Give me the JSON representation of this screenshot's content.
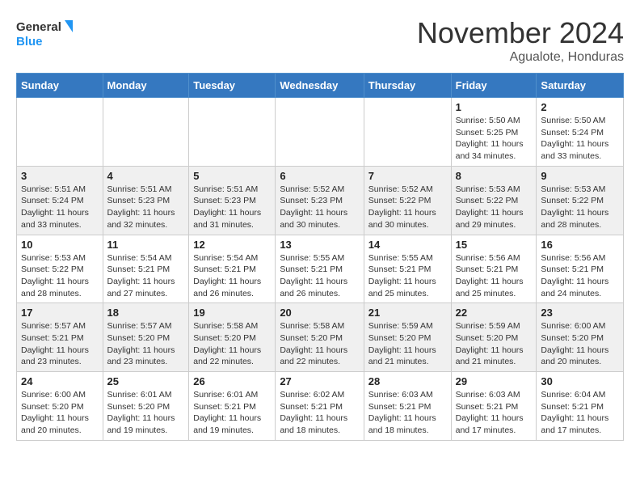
{
  "header": {
    "logo_general": "General",
    "logo_blue": "Blue",
    "month_title": "November 2024",
    "location": "Agualote, Honduras"
  },
  "calendar": {
    "days_of_week": [
      "Sunday",
      "Monday",
      "Tuesday",
      "Wednesday",
      "Thursday",
      "Friday",
      "Saturday"
    ],
    "weeks": [
      [
        {
          "day": "",
          "info": ""
        },
        {
          "day": "",
          "info": ""
        },
        {
          "day": "",
          "info": ""
        },
        {
          "day": "",
          "info": ""
        },
        {
          "day": "",
          "info": ""
        },
        {
          "day": "1",
          "info": "Sunrise: 5:50 AM\nSunset: 5:25 PM\nDaylight: 11 hours and 34 minutes."
        },
        {
          "day": "2",
          "info": "Sunrise: 5:50 AM\nSunset: 5:24 PM\nDaylight: 11 hours and 33 minutes."
        }
      ],
      [
        {
          "day": "3",
          "info": "Sunrise: 5:51 AM\nSunset: 5:24 PM\nDaylight: 11 hours and 33 minutes."
        },
        {
          "day": "4",
          "info": "Sunrise: 5:51 AM\nSunset: 5:23 PM\nDaylight: 11 hours and 32 minutes."
        },
        {
          "day": "5",
          "info": "Sunrise: 5:51 AM\nSunset: 5:23 PM\nDaylight: 11 hours and 31 minutes."
        },
        {
          "day": "6",
          "info": "Sunrise: 5:52 AM\nSunset: 5:23 PM\nDaylight: 11 hours and 30 minutes."
        },
        {
          "day": "7",
          "info": "Sunrise: 5:52 AM\nSunset: 5:22 PM\nDaylight: 11 hours and 30 minutes."
        },
        {
          "day": "8",
          "info": "Sunrise: 5:53 AM\nSunset: 5:22 PM\nDaylight: 11 hours and 29 minutes."
        },
        {
          "day": "9",
          "info": "Sunrise: 5:53 AM\nSunset: 5:22 PM\nDaylight: 11 hours and 28 minutes."
        }
      ],
      [
        {
          "day": "10",
          "info": "Sunrise: 5:53 AM\nSunset: 5:22 PM\nDaylight: 11 hours and 28 minutes."
        },
        {
          "day": "11",
          "info": "Sunrise: 5:54 AM\nSunset: 5:21 PM\nDaylight: 11 hours and 27 minutes."
        },
        {
          "day": "12",
          "info": "Sunrise: 5:54 AM\nSunset: 5:21 PM\nDaylight: 11 hours and 26 minutes."
        },
        {
          "day": "13",
          "info": "Sunrise: 5:55 AM\nSunset: 5:21 PM\nDaylight: 11 hours and 26 minutes."
        },
        {
          "day": "14",
          "info": "Sunrise: 5:55 AM\nSunset: 5:21 PM\nDaylight: 11 hours and 25 minutes."
        },
        {
          "day": "15",
          "info": "Sunrise: 5:56 AM\nSunset: 5:21 PM\nDaylight: 11 hours and 25 minutes."
        },
        {
          "day": "16",
          "info": "Sunrise: 5:56 AM\nSunset: 5:21 PM\nDaylight: 11 hours and 24 minutes."
        }
      ],
      [
        {
          "day": "17",
          "info": "Sunrise: 5:57 AM\nSunset: 5:21 PM\nDaylight: 11 hours and 23 minutes."
        },
        {
          "day": "18",
          "info": "Sunrise: 5:57 AM\nSunset: 5:20 PM\nDaylight: 11 hours and 23 minutes."
        },
        {
          "day": "19",
          "info": "Sunrise: 5:58 AM\nSunset: 5:20 PM\nDaylight: 11 hours and 22 minutes."
        },
        {
          "day": "20",
          "info": "Sunrise: 5:58 AM\nSunset: 5:20 PM\nDaylight: 11 hours and 22 minutes."
        },
        {
          "day": "21",
          "info": "Sunrise: 5:59 AM\nSunset: 5:20 PM\nDaylight: 11 hours and 21 minutes."
        },
        {
          "day": "22",
          "info": "Sunrise: 5:59 AM\nSunset: 5:20 PM\nDaylight: 11 hours and 21 minutes."
        },
        {
          "day": "23",
          "info": "Sunrise: 6:00 AM\nSunset: 5:20 PM\nDaylight: 11 hours and 20 minutes."
        }
      ],
      [
        {
          "day": "24",
          "info": "Sunrise: 6:00 AM\nSunset: 5:20 PM\nDaylight: 11 hours and 20 minutes."
        },
        {
          "day": "25",
          "info": "Sunrise: 6:01 AM\nSunset: 5:20 PM\nDaylight: 11 hours and 19 minutes."
        },
        {
          "day": "26",
          "info": "Sunrise: 6:01 AM\nSunset: 5:21 PM\nDaylight: 11 hours and 19 minutes."
        },
        {
          "day": "27",
          "info": "Sunrise: 6:02 AM\nSunset: 5:21 PM\nDaylight: 11 hours and 18 minutes."
        },
        {
          "day": "28",
          "info": "Sunrise: 6:03 AM\nSunset: 5:21 PM\nDaylight: 11 hours and 18 minutes."
        },
        {
          "day": "29",
          "info": "Sunrise: 6:03 AM\nSunset: 5:21 PM\nDaylight: 11 hours and 17 minutes."
        },
        {
          "day": "30",
          "info": "Sunrise: 6:04 AM\nSunset: 5:21 PM\nDaylight: 11 hours and 17 minutes."
        }
      ]
    ]
  }
}
